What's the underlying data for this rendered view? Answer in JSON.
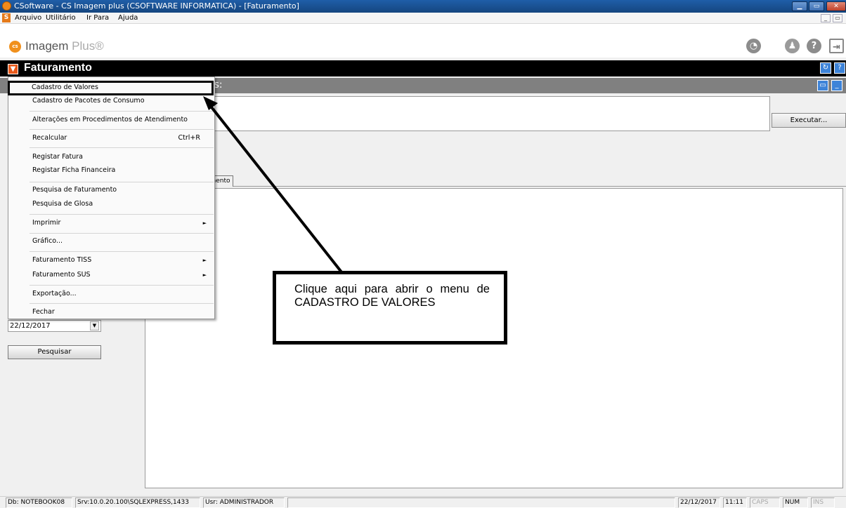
{
  "window": {
    "title": "CSoftware - CS Imagem plus (CSOFTWARE INFORMATICA) - [Faturamento]",
    "minimize": "▁",
    "maximize": "▭",
    "close": "✕"
  },
  "menubar": {
    "icon": "S",
    "items": [
      "Arquivo",
      "Utilitário",
      "Ir Para",
      "Ajuda"
    ],
    "mdi_buttons": [
      "_",
      "▭"
    ]
  },
  "logo": {
    "badge": "cs",
    "brand": "Imagem",
    "suffix": "Plus®"
  },
  "top_icons": {
    "globe": "◔",
    "user": "♟",
    "help": "?",
    "exit": "⇥"
  },
  "module": {
    "title": "Faturamento",
    "menu_glyph": "▼",
    "refresh_glyph": "↻",
    "help_glyph": "?"
  },
  "panel": {
    "header_visible_text": "os:",
    "buttons": [
      "▭",
      "_"
    ]
  },
  "execute_button": "Executar...",
  "tab_label_partial": "imento",
  "date_field": {
    "value": "22/12/2017",
    "arrow": "▼"
  },
  "search_button": "Pesquisar",
  "dropdown": {
    "items": [
      {
        "label": "Cadastro de Valores"
      },
      {
        "label": "Cadastro de Pacotes de Consumo"
      },
      {
        "label": "Alterações em Procedimentos de Atendimento"
      },
      {
        "label": "Recalcular",
        "shortcut": "Ctrl+R"
      },
      {
        "label": "Registar Fatura"
      },
      {
        "label": "Registar Ficha Financeira"
      },
      {
        "label": "Pesquisa de Faturamento"
      },
      {
        "label": "Pesquisa de Glosa"
      },
      {
        "label": "Imprimir",
        "submenu": "►"
      },
      {
        "label": "Gráfico..."
      },
      {
        "label": "Faturamento TISS",
        "submenu": "►"
      },
      {
        "label": "Faturamento SUS",
        "submenu": "►"
      },
      {
        "label": "Exportação..."
      },
      {
        "label": "Fechar"
      }
    ]
  },
  "callout": {
    "text": "Clique aqui para abrir o menu de CADASTRO DE VALORES"
  },
  "statusbar": {
    "db": "Db: NOTEBOOK08",
    "srv": "Srv:10.0.20.100\\SQLEXPRESS,1433",
    "usr": "Usr: ADMINISTRADOR",
    "date": "22/12/2017",
    "time": "11:11",
    "caps": "CAPS",
    "num": "NUM",
    "ins": "INS"
  }
}
